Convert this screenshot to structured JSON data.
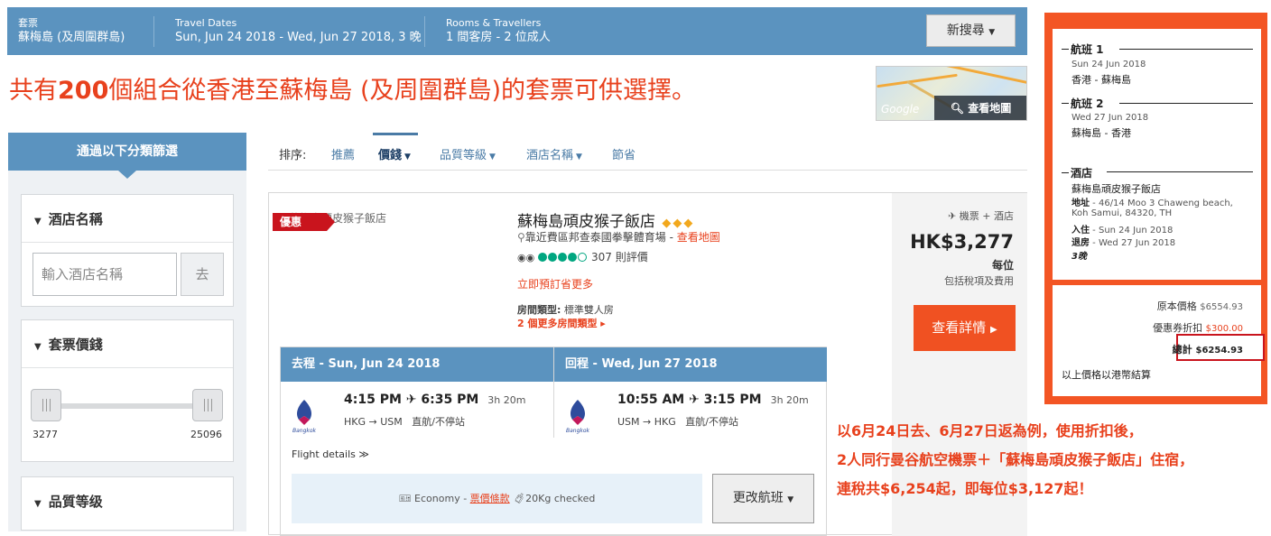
{
  "topbar": {
    "package_label": "套票",
    "package_value": "蘇梅島 (及周圍群島)",
    "dates_label": "Travel Dates",
    "dates_value": "Sun, Jun 24 2018 - Wed, Jun 27 2018, 3 晚",
    "rooms_label": "Rooms & Travellers",
    "rooms_value": "1 間客房 - 2 位成人",
    "new_search": "新搜尋"
  },
  "headline": {
    "pre": "共有",
    "count": "200",
    "post": "個組合從香港至蘇梅島 (及周圍群島)的套票可供選擇。"
  },
  "map": {
    "google": "Google",
    "view_map": "查看地圖"
  },
  "filters": {
    "header": "通過以下分類篩選",
    "hotel_name_title": "酒店名稱",
    "hotel_name_placeholder": "輸入酒店名稱",
    "go": "去",
    "price_title": "套票價錢",
    "price_min": "3277",
    "price_max": "25096",
    "quality_title": "品質等级"
  },
  "sort": {
    "label": "排序:",
    "items": [
      "推薦",
      "價錢",
      "品質等級",
      "酒店名稱",
      "節省"
    ],
    "active": "價錢"
  },
  "card": {
    "image_alt": "蘇梅島頑皮猴子飯店",
    "promo": "優惠",
    "hotel_name": "蘇梅島頑皮猴子飯店",
    "stars": 3,
    "location": "靠近費區邦查泰國拳擊體育場 - ",
    "view_map": "查看地圖",
    "reviews": "307 則評價",
    "rating": 4,
    "book_now": "立即預訂省更多",
    "room_type_label": "房間類型:",
    "room_type": "標準雙人房",
    "more_rooms": "2 個更多房間類型 ▸",
    "package_type": "機票 + 酒店",
    "price": "HK$3,277",
    "per_person": "每位",
    "includes": "包括稅項及費用",
    "details_button": "查看詳情"
  },
  "flights": {
    "outbound_header": "去程 - Sun, Jun 24 2018",
    "return_header": "回程 - Wed, Jun 27 2018",
    "airline": "Bangkok Airways",
    "outbound_time": "4:15 PM ✈ 6:35 PM",
    "outbound_duration": "3h 20m",
    "outbound_route": "HKG → USM",
    "outbound_type": "直航/不停站",
    "return_time": "10:55 AM ✈ 3:15 PM",
    "return_duration": "3h 20m",
    "return_route": "USM → HKG",
    "return_type": "直航/不停站",
    "details": "Flight details ≫",
    "economy": "Economy - ",
    "fare_rules": "票價條款",
    "baggage": "20Kg checked",
    "change_flight": "更改航班"
  },
  "summary": {
    "flight1_title": "航班 1",
    "flight1_date": "Sun 24 Jun 2018",
    "flight1_route": "香港 - 蘇梅島",
    "flight2_title": "航班 2",
    "flight2_date": "Wed 27 Jun 2018",
    "flight2_route": "蘇梅島 - 香港",
    "hotel_title": "酒店",
    "hotel_name": "蘇梅島頑皮猴子飯店",
    "address_label": "地址",
    "address": " - 46/14 Moo 3 Chaweng beach,",
    "address2": "Koh Samui, 84320, TH",
    "checkin_label": "入住",
    "checkin": " - Sun 24 Jun 2018",
    "checkout_label": "退房",
    "checkout": " - Wed 27 Jun 2018",
    "nights": "3晚",
    "original_label": "原本價格",
    "original_value": "$6554.93",
    "discount_label": "優惠券折扣",
    "discount_value": "$300.00",
    "total_label": "總計",
    "total_value": "$6254.93",
    "currency_note": "以上價格以港幣結算"
  },
  "annotation": {
    "line1": "以6月24日去、6月27日返為例，使用折扣後，",
    "line2": "2人同行曼谷航空機票＋「蘇梅島頑皮猴子飯店」住宿，",
    "line3": "連稅共$6,254起，即每位$3,127起！"
  },
  "colors": {
    "brand_blue": "#5b93bf",
    "accent_orange": "#f05122",
    "summary_orange": "#f35524",
    "headline_red": "#e8411d"
  }
}
